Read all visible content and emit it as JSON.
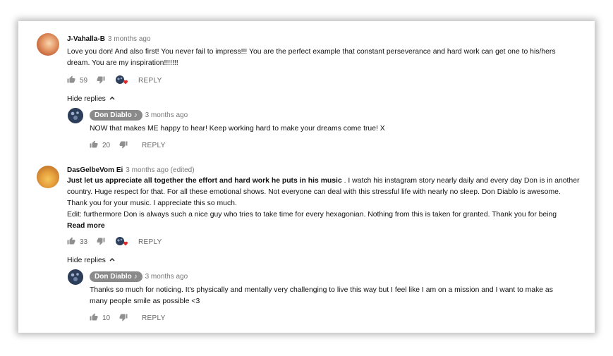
{
  "comments": [
    {
      "author": "J-Vahalla-B",
      "time": "3 months ago",
      "text_lines": [
        "Love you don! And also first! You never fail to impress!!! You are the perfect example that constant perseverance and hard work can get one to his/hers",
        "dream. You are my inspiration!!!!!!!"
      ],
      "likes": "59",
      "reply_label": "REPLY",
      "hide_replies_label": "Hide replies",
      "reply": {
        "author": "Don Diablo",
        "time": "3 months ago",
        "text": "NOW that makes ME happy to hear! Keep working hard to make your dreams come true! X",
        "likes": "20",
        "reply_label": "REPLY"
      }
    },
    {
      "author": "DasGelbeVom Ei",
      "time": "3 months ago (edited)",
      "bold_text": "Just let us appreciate all together the effort and hard work he puts in his music",
      "text_line1_rest": " . I watch his instagram story nearly daily and every day Don is in another",
      "text_lines": [
        "country. Huge respect for that. For all these emotional shows. Not everyone can deal with this stressful life with nearly no sleep. Don Diablo is awesome.",
        "Thank you for your music. I appreciate this so much.",
        "Edit: furthermore Don is always such a nice guy who tries to take time for every hexagonian. Nothing from this is taken for granted. Thank you for being"
      ],
      "read_more": "Read more",
      "likes": "33",
      "reply_label": "REPLY",
      "hide_replies_label": "Hide replies",
      "reply": {
        "author": "Don Diablo",
        "time": "3 months ago",
        "text_lines": [
          "Thanks so much for noticing. It's physically and mentally very challenging to live this way but I feel like I am on a mission and I want to make as",
          "many people smile as possible <3"
        ],
        "likes": "10",
        "reply_label": "REPLY"
      }
    }
  ],
  "icons": {
    "like": "thumbs-up-icon",
    "dislike": "thumbs-down-icon",
    "creator_heart": "creator-heart-icon",
    "chevron": "chevron-up-icon",
    "note": "music-note-icon"
  },
  "colors": {
    "heart": "#e02b2b",
    "badge": "#8a8a8a"
  }
}
